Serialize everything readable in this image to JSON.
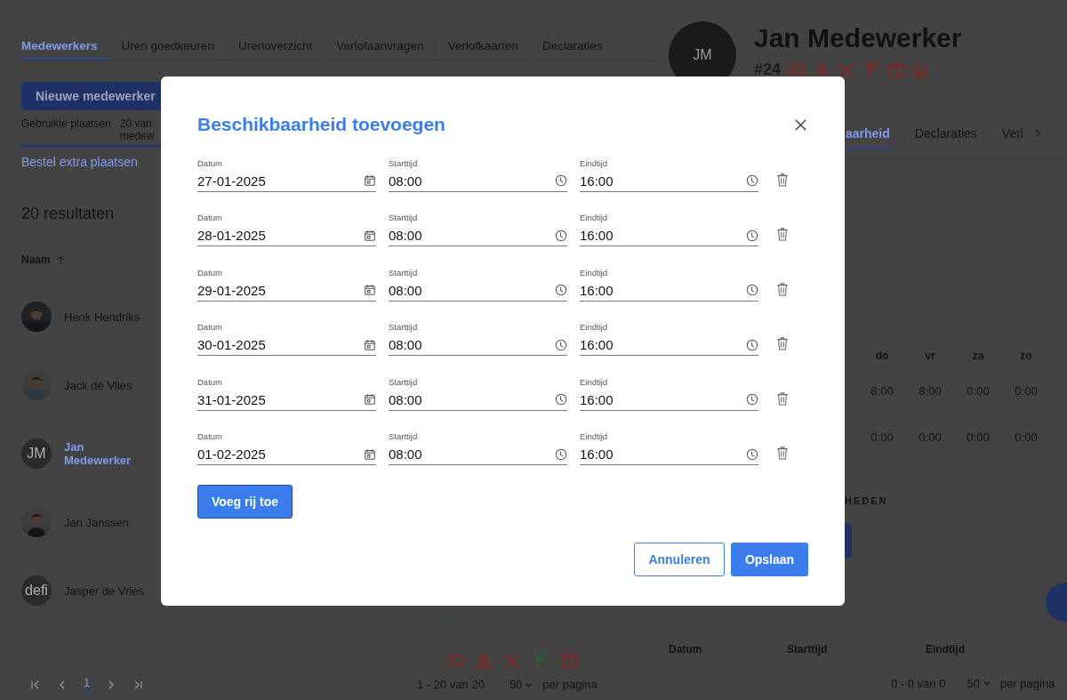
{
  "main_tabs": [
    {
      "label": "Medewerkers",
      "selected": true
    },
    {
      "label": "Uren goedkeuren",
      "selected": false
    },
    {
      "label": "Urenoverzicht",
      "selected": false
    },
    {
      "label": "Verlofaanvragen",
      "selected": false
    },
    {
      "label": "Verlofkaarten",
      "selected": false
    },
    {
      "label": "Declaraties",
      "selected": false
    }
  ],
  "new_employee_button": "Nieuwe medewerker",
  "seats": {
    "label": "Gebruikte plaatsen",
    "count": "20 van medew",
    "level": 1
  },
  "order_link": "Bestel extra plaatsen",
  "result_count": "20 resultaten",
  "name_header": "Naam",
  "employees": [
    {
      "name": "Henk Hendriks",
      "selected": false
    },
    {
      "name": "Jack de Vlies",
      "selected": false
    },
    {
      "name": "Jan Medewerker",
      "kind": "initials",
      "initials": "JM",
      "selected": true
    },
    {
      "name": "Jan Janssen",
      "selected": false
    },
    {
      "name": "Jasper de Vries",
      "kind": "initials",
      "initials": "defi",
      "selected": false
    }
  ],
  "pages": [
    {
      "label": "1",
      "selected": true
    }
  ],
  "row_badges": [
    {
      "kind": "invoice",
      "color": "#7a2a24"
    },
    {
      "kind": "worker",
      "color": "#7a2a24"
    },
    {
      "kind": "tools",
      "color": "#7a2a24"
    },
    {
      "kind": "flag",
      "color": "#2e5a3a"
    },
    {
      "kind": "box",
      "color": "#7a2a24"
    }
  ],
  "list_footer": {
    "range": "1 - 20 van 20",
    "page_size": "50",
    "per_page": "per pagina"
  },
  "profile": {
    "initials": "JM",
    "name": "Jan Medewerker",
    "number": "#24",
    "badges": [
      {
        "kind": "invoice",
        "color": "#7a2a24"
      },
      {
        "kind": "worker",
        "color": "#7a2a24"
      },
      {
        "kind": "tools",
        "color": "#7a2a24"
      },
      {
        "kind": "flag",
        "color": "#7a2a24"
      },
      {
        "kind": "box",
        "color": "#7a2a24"
      },
      {
        "kind": "forklift",
        "color": "#7a2a24"
      }
    ]
  },
  "profile_tabs": [
    {
      "label": "aarheid",
      "selected": true
    },
    {
      "label": "Declaraties",
      "selected": false
    },
    {
      "label": "Verl",
      "selected": false
    }
  ],
  "schedule": {
    "days": [
      "do",
      "vr",
      "za",
      "zo"
    ],
    "rows": [
      [
        "8:00",
        "8:00",
        "0:00",
        "0:00"
      ],
      [
        "0:00",
        "0:00",
        "0:00",
        "0:00"
      ]
    ]
  },
  "section_heading": "HEDEN",
  "availability_table": {
    "columns": [
      "Datum",
      "Starttijd",
      "Eindtijd"
    ],
    "range": "0 - 0 van 0",
    "page_size": "50",
    "per_page": "per pagina"
  },
  "dialog": {
    "title": "Beschikbaarheid toevoegen",
    "rows": [
      [
        {
          "kind": "date",
          "label": "Datum",
          "value": "27-01-2025"
        },
        {
          "kind": "time",
          "label": "Starttijd",
          "value": "08:00"
        },
        {
          "kind": "time",
          "label": "Eindtijd",
          "value": "16:00"
        }
      ],
      [
        {
          "kind": "date",
          "label": "Datum",
          "value": "28-01-2025"
        },
        {
          "kind": "time",
          "label": "Starttijd",
          "value": "08:00"
        },
        {
          "kind": "time",
          "label": "Eindtijd",
          "value": "16:00"
        }
      ],
      [
        {
          "kind": "date",
          "label": "Datum",
          "value": "29-01-2025"
        },
        {
          "kind": "time",
          "label": "Starttijd",
          "value": "08:00"
        },
        {
          "kind": "time",
          "label": "Eindtijd",
          "value": "16:00"
        }
      ],
      [
        {
          "kind": "date",
          "label": "Datum",
          "value": "30-01-2025"
        },
        {
          "kind": "time",
          "label": "Starttijd",
          "value": "08:00"
        },
        {
          "kind": "time",
          "label": "Eindtijd",
          "value": "16:00"
        }
      ],
      [
        {
          "kind": "date",
          "label": "Datum",
          "value": "31-01-2025"
        },
        {
          "kind": "time",
          "label": "Starttijd",
          "value": "08:00"
        },
        {
          "kind": "time",
          "label": "Eindtijd",
          "value": "16:00"
        }
      ],
      [
        {
          "kind": "date",
          "label": "Datum",
          "value": "01-02-2025"
        },
        {
          "kind": "time",
          "label": "Starttijd",
          "value": "08:00"
        },
        {
          "kind": "time",
          "label": "Eindtijd",
          "value": "16:00"
        }
      ]
    ],
    "add_row_button": "Voeg rij toe",
    "cancel_button": "Annuleren",
    "save_button": "Opslaan"
  }
}
